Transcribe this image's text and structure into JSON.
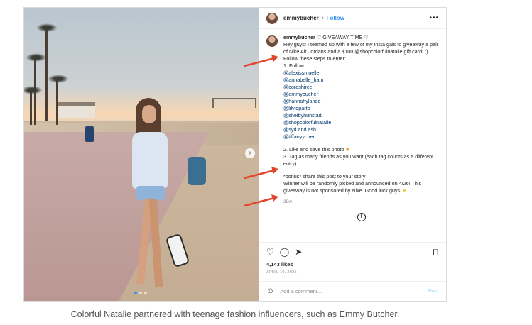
{
  "post": {
    "username": "emmybucher",
    "follow_label": "Follow",
    "more_label": "•••",
    "caption_lines": [
      "Hey guys! I teamed up with a few of my Insta gals to giveaway a pair of Nike Air Jordans and a $100 @shopcolorfulnatalie gift card! :)",
      "Follow these steps to enter:",
      "1. Follow:"
    ],
    "giveaway_title": "GIVEAWAY TIME",
    "mentions": [
      "@alexissmueller",
      "@annabelle_ham",
      "@corashircel",
      "@emmybucher",
      "@hannahylandd",
      "@lilyloparto",
      "@shelbyhunstad",
      "@shopcolorfulnatalie",
      "@syd.and.ash",
      "@tiffanyychen"
    ],
    "step2": "2. Like and save this photo",
    "step3": "3. Tag as many friends as you want (each tag counts as a different entry)",
    "bonus": "*bonus* share this post to your story",
    "winner": "Winner will be randomly picked and announced on 4/26! This giveaway is not sponsored by Nike. Good luck guys!",
    "time_ago": "39w",
    "likes": "4,143 likes",
    "date": "APRIL 19, 2021",
    "comment_placeholder": "Add a comment...",
    "post_label": "Post"
  },
  "image_caption": "Colorful Natalie partnered with teenage fashion influencers, such as Emmy Butcher.",
  "colors": {
    "link": "#00376b",
    "follow": "#3897f0",
    "arrow": "#e2452b"
  }
}
